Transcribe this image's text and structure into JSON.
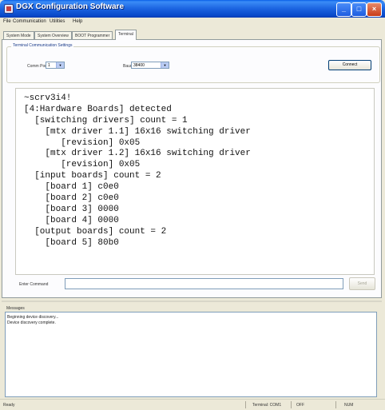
{
  "window": {
    "title": "DGX Configuration Software",
    "minimize_glyph": "_",
    "maximize_glyph": "□",
    "close_glyph": "×"
  },
  "menu": [
    "File",
    "Communication",
    "Utilities",
    "Help"
  ],
  "tabs": [
    "System Mode",
    "System Overview",
    "BOOT Programmer",
    "Terminal"
  ],
  "active_tab": "Terminal",
  "settings": {
    "group_label": "Terminal Communication Settings",
    "com_port_label": "Comm Port",
    "com_port_value": "1",
    "baud_label": "Baud",
    "baud_value": "38400",
    "connect_label": "Connect"
  },
  "terminal": {
    "lines": [
      "~scrv3i4!",
      "[4:Hardware Boards] detected",
      "  [switching drivers] count = 1",
      "    [mtx driver 1.1] 16x16 switching driver",
      "       [revision] 0x05",
      "    [mtx driver 1.2] 16x16 switching driver",
      "       [revision] 0x05",
      "  [input boards] count = 2",
      "    [board 1] c0e0",
      "    [board 2] c0e0",
      "    [board 3] 0000",
      "    [board 4] 0000",
      "  [output boards] count = 2",
      "    [board 5] 80b0"
    ]
  },
  "command": {
    "label": "Enter Command",
    "value": "",
    "send_label": "Send"
  },
  "messages": {
    "label": "Messages",
    "items": [
      "Beginning device discovery...",
      "Device discovery complete."
    ]
  },
  "status": {
    "left": "Ready",
    "terminal": "Terminal: COM1",
    "state": "OFF",
    "mode": "NUM"
  },
  "colors": {
    "title_bar": "#1b63e0",
    "window_bg": "#ece9d8",
    "terminal_bg": "#ffffff"
  }
}
